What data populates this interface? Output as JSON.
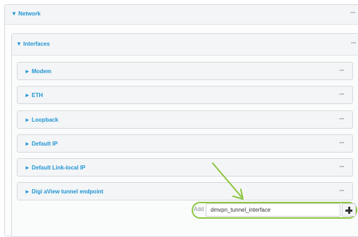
{
  "network": {
    "title": "▼ Network",
    "more": "···",
    "interfaces": {
      "title": "▼ Interfaces",
      "more": "···",
      "items": [
        {
          "label": "► Modem",
          "more": "···"
        },
        {
          "label": "► ETH",
          "more": "···"
        },
        {
          "label": "► Loopback",
          "more": "···"
        },
        {
          "label": "► Default IP",
          "more": "···"
        },
        {
          "label": "► Default Link-local IP",
          "more": "···"
        },
        {
          "label": "► Digi aView tunnel endpoint",
          "more": "···"
        }
      ],
      "add": {
        "label": "Add",
        "value": "dmvpn_tunnel_interface"
      }
    }
  },
  "colors": {
    "accent": "#1f95d3",
    "highlight": "#8cc63f"
  }
}
